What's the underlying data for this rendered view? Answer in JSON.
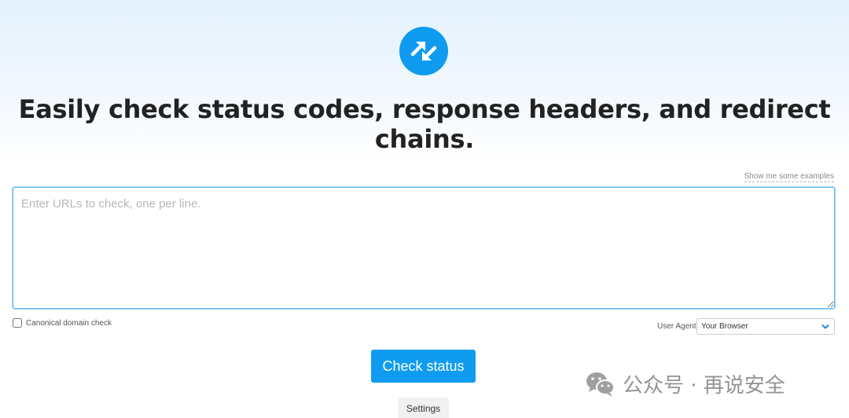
{
  "logo": {
    "icon": "arrows-in-out-icon",
    "color": "#0f9cf0"
  },
  "headline": {
    "part1": "Easily check ",
    "bold1": "status codes",
    "part2": ", ",
    "bold2": "response headers",
    "part3": ", and ",
    "bold3": "redirect chains",
    "part4": "."
  },
  "examples_link": "Show me some examples",
  "url_input": {
    "placeholder": "Enter URLs to check, one per line.",
    "value": ""
  },
  "canonical": {
    "label": "Canonical domain check",
    "checked": false
  },
  "user_agent": {
    "label": "User Agent:",
    "selected": "Your Browser",
    "icon": "chevron-down-icon"
  },
  "check_button": {
    "label": "Check status",
    "color": "#0f9cf0"
  },
  "settings_button": {
    "label": "Settings"
  },
  "watermark": {
    "icon": "wechat-icon",
    "text": "公众号 · 再说安全"
  }
}
